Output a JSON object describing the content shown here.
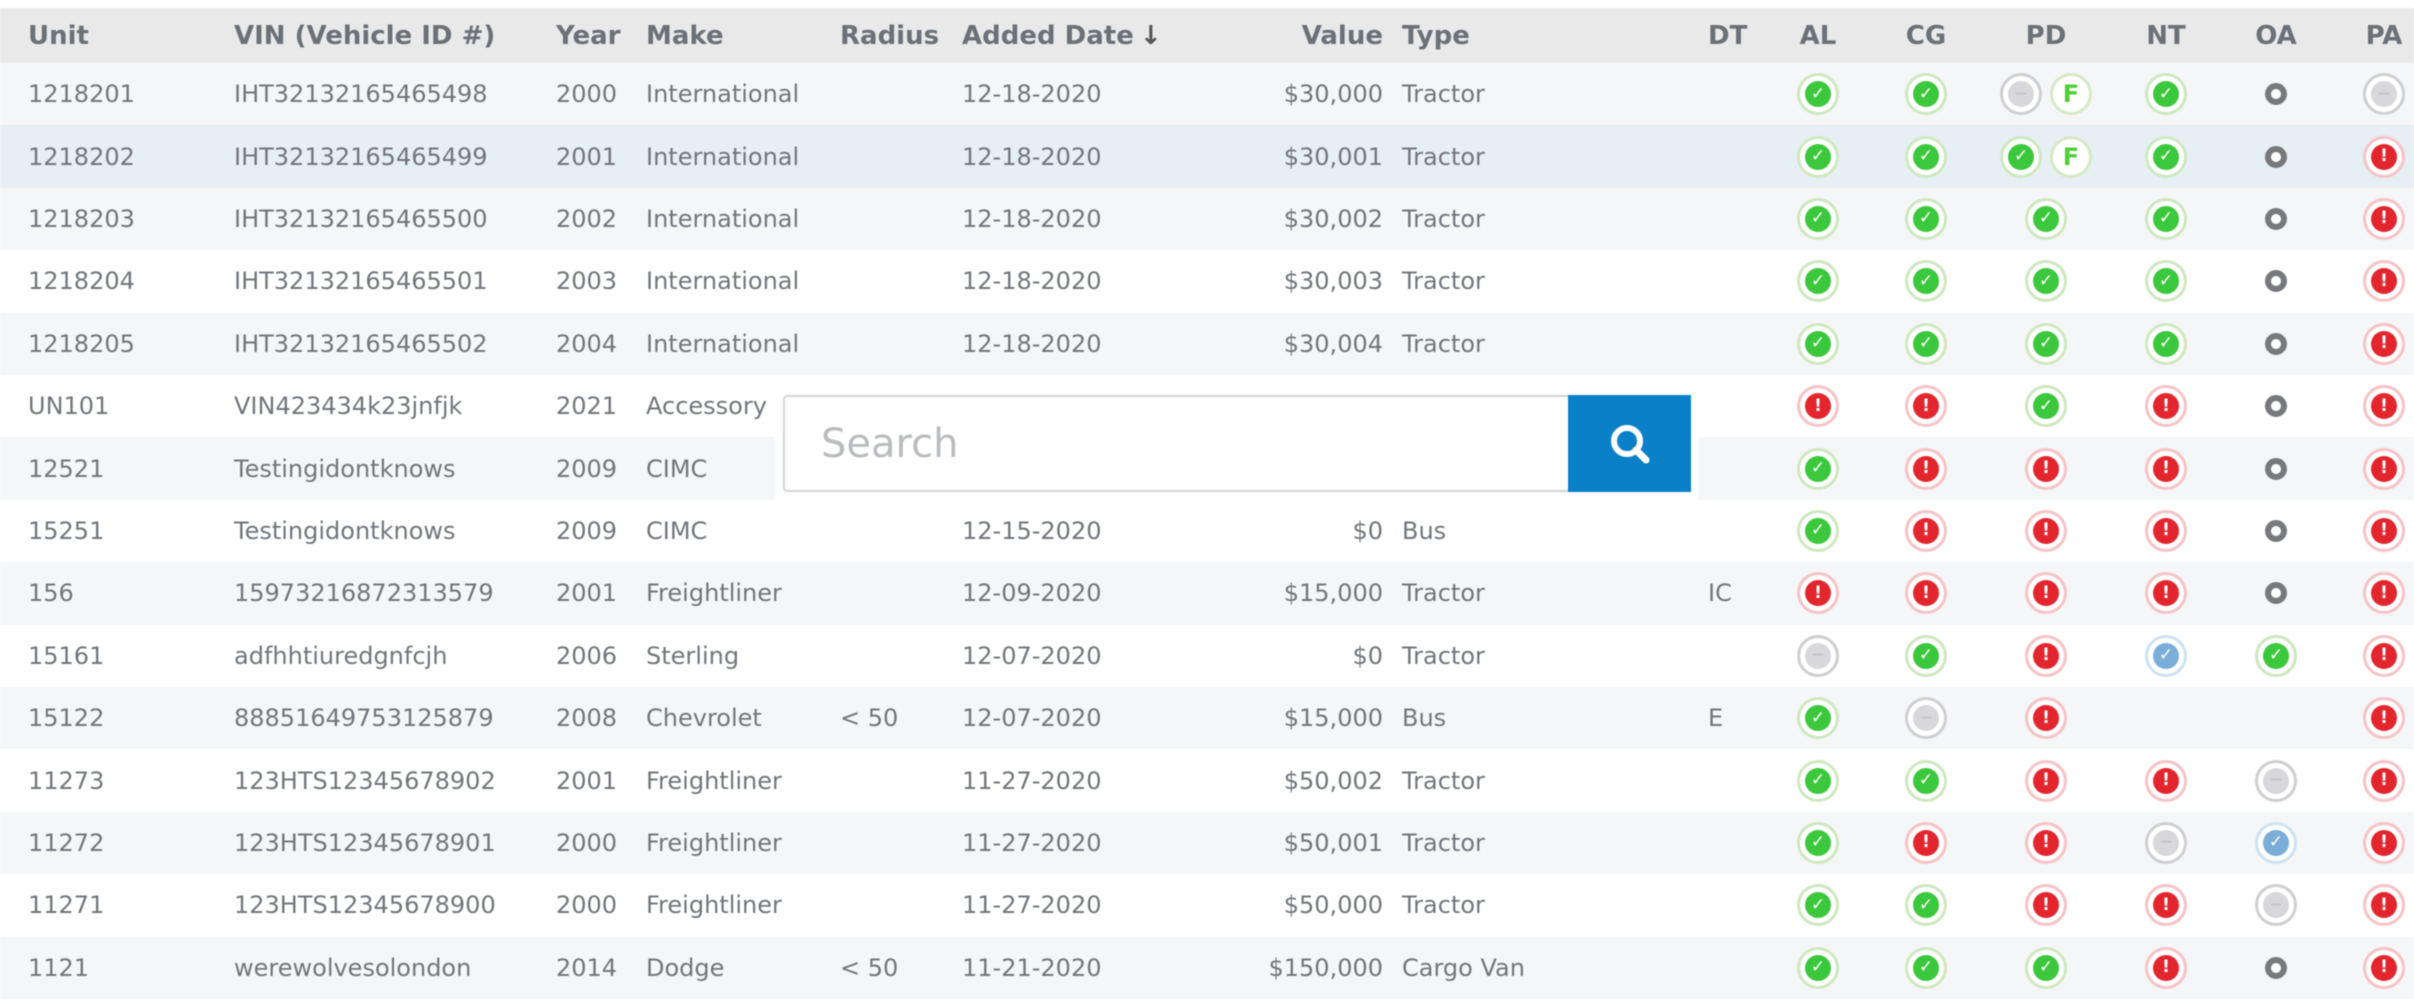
{
  "colors": {
    "accent": "#0a80c9",
    "ok": "#3cc83c",
    "alert": "#e3262e",
    "info": "#7aaed8",
    "neutral": "#d8d8da",
    "header_bg": "#e9e9ea",
    "row_alt_bg": "#f5f6f8",
    "row_selected_bg": "#e6eff4"
  },
  "search": {
    "placeholder": "Search",
    "value": "",
    "button_icon": "search-icon"
  },
  "table": {
    "columns": [
      {
        "key": "unit",
        "label": "Unit"
      },
      {
        "key": "vin",
        "label": "VIN (Vehicle ID #)"
      },
      {
        "key": "year",
        "label": "Year"
      },
      {
        "key": "make",
        "label": "Make"
      },
      {
        "key": "radius",
        "label": "Radius"
      },
      {
        "key": "added_date",
        "label": "Added Date",
        "sort": "descending",
        "sort_icon": "↓"
      },
      {
        "key": "value",
        "label": "Value"
      },
      {
        "key": "type",
        "label": "Type"
      },
      {
        "key": "dt",
        "label": "DT"
      },
      {
        "key": "al",
        "label": "AL"
      },
      {
        "key": "cg",
        "label": "CG"
      },
      {
        "key": "pd",
        "label": "PD"
      },
      {
        "key": "nt",
        "label": "NT"
      },
      {
        "key": "oa",
        "label": "OA"
      },
      {
        "key": "pa",
        "label": "PA"
      }
    ],
    "status_legend": {
      "ok": "check-circle-icon",
      "alert": "exclamation-circle-icon",
      "minus": "minus-circle-icon",
      "info": "check-circle-blue-icon",
      "flag": "f-badge-icon",
      "plus": "ring-icon",
      "none": ""
    },
    "selected_row_index": 1,
    "rows": [
      {
        "unit": "1218201",
        "vin": "IHT32132165465498",
        "year": "2000",
        "make": "International",
        "radius": "",
        "added_date": "12-18-2020",
        "value": "$30,000",
        "type": "Tractor",
        "dt": "",
        "al": [
          "ok"
        ],
        "cg": [
          "ok"
        ],
        "pd": [
          "minus",
          "flag"
        ],
        "nt": [
          "ok"
        ],
        "oa": [
          "plus"
        ],
        "pa": [
          "minus"
        ]
      },
      {
        "unit": "1218202",
        "vin": "IHT32132165465499",
        "year": "2001",
        "make": "International",
        "radius": "",
        "added_date": "12-18-2020",
        "value": "$30,001",
        "type": "Tractor",
        "dt": "",
        "al": [
          "ok"
        ],
        "cg": [
          "ok"
        ],
        "pd": [
          "ok",
          "flag"
        ],
        "nt": [
          "ok"
        ],
        "oa": [
          "plus"
        ],
        "pa": [
          "alert"
        ]
      },
      {
        "unit": "1218203",
        "vin": "IHT32132165465500",
        "year": "2002",
        "make": "International",
        "radius": "",
        "added_date": "12-18-2020",
        "value": "$30,002",
        "type": "Tractor",
        "dt": "",
        "al": [
          "ok"
        ],
        "cg": [
          "ok"
        ],
        "pd": [
          "ok"
        ],
        "nt": [
          "ok"
        ],
        "oa": [
          "plus"
        ],
        "pa": [
          "alert"
        ]
      },
      {
        "unit": "1218204",
        "vin": "IHT32132165465501",
        "year": "2003",
        "make": "International",
        "radius": "",
        "added_date": "12-18-2020",
        "value": "$30,003",
        "type": "Tractor",
        "dt": "",
        "al": [
          "ok"
        ],
        "cg": [
          "ok"
        ],
        "pd": [
          "ok"
        ],
        "nt": [
          "ok"
        ],
        "oa": [
          "plus"
        ],
        "pa": [
          "alert"
        ]
      },
      {
        "unit": "1218205",
        "vin": "IHT32132165465502",
        "year": "2004",
        "make": "International",
        "radius": "",
        "added_date": "12-18-2020",
        "value": "$30,004",
        "type": "Tractor",
        "dt": "",
        "al": [
          "ok"
        ],
        "cg": [
          "ok"
        ],
        "pd": [
          "ok"
        ],
        "nt": [
          "ok"
        ],
        "oa": [
          "plus"
        ],
        "pa": [
          "alert"
        ]
      },
      {
        "unit": "UN101",
        "vin": "VIN423434k23jnfjk",
        "year": "2021",
        "make": "Accessory",
        "radius": "",
        "added_date": "",
        "value": "",
        "type": "",
        "dt": "",
        "al": [
          "alert"
        ],
        "cg": [
          "alert"
        ],
        "pd": [
          "ok"
        ],
        "nt": [
          "alert"
        ],
        "oa": [
          "plus"
        ],
        "pa": [
          "alert"
        ]
      },
      {
        "unit": "12521",
        "vin": "Testingidontknows",
        "year": "2009",
        "make": "CIMC",
        "radius": "",
        "added_date": "",
        "value": "",
        "type": "",
        "dt": "",
        "al": [
          "ok"
        ],
        "cg": [
          "alert"
        ],
        "pd": [
          "alert"
        ],
        "nt": [
          "alert"
        ],
        "oa": [
          "plus"
        ],
        "pa": [
          "alert"
        ]
      },
      {
        "unit": "15251",
        "vin": "Testingidontknows",
        "year": "2009",
        "make": "CIMC",
        "radius": "",
        "added_date": "12-15-2020",
        "value": "$0",
        "type": "Bus",
        "dt": "",
        "al": [
          "ok"
        ],
        "cg": [
          "alert"
        ],
        "pd": [
          "alert"
        ],
        "nt": [
          "alert"
        ],
        "oa": [
          "plus"
        ],
        "pa": [
          "alert"
        ]
      },
      {
        "unit": "156",
        "vin": "15973216872313579",
        "year": "2001",
        "make": "Freightliner",
        "radius": "",
        "added_date": "12-09-2020",
        "value": "$15,000",
        "type": "Tractor",
        "dt": "IC",
        "al": [
          "alert"
        ],
        "cg": [
          "alert"
        ],
        "pd": [
          "alert"
        ],
        "nt": [
          "alert"
        ],
        "oa": [
          "plus"
        ],
        "pa": [
          "alert"
        ]
      },
      {
        "unit": "15161",
        "vin": "adfhhtiuredgnfcjh",
        "year": "2006",
        "make": "Sterling",
        "radius": "",
        "added_date": "12-07-2020",
        "value": "$0",
        "type": "Tractor",
        "dt": "",
        "al": [
          "minus"
        ],
        "cg": [
          "ok"
        ],
        "pd": [
          "alert"
        ],
        "nt": [
          "info"
        ],
        "oa": [
          "ok"
        ],
        "pa": [
          "alert"
        ]
      },
      {
        "unit": "15122",
        "vin": "88851649753125879",
        "year": "2008",
        "make": "Chevrolet",
        "radius": "< 50",
        "added_date": "12-07-2020",
        "value": "$15,000",
        "type": "Bus",
        "dt": "E",
        "al": [
          "ok"
        ],
        "cg": [
          "minus"
        ],
        "pd": [
          "alert"
        ],
        "nt": [],
        "oa": [],
        "pa": [
          "alert"
        ]
      },
      {
        "unit": "11273",
        "vin": "123HTS12345678902",
        "year": "2001",
        "make": "Freightliner",
        "radius": "",
        "added_date": "11-27-2020",
        "value": "$50,002",
        "type": "Tractor",
        "dt": "",
        "al": [
          "ok"
        ],
        "cg": [
          "ok"
        ],
        "pd": [
          "alert"
        ],
        "nt": [
          "alert"
        ],
        "oa": [
          "minus"
        ],
        "pa": [
          "alert"
        ]
      },
      {
        "unit": "11272",
        "vin": "123HTS12345678901",
        "year": "2000",
        "make": "Freightliner",
        "radius": "",
        "added_date": "11-27-2020",
        "value": "$50,001",
        "type": "Tractor",
        "dt": "",
        "al": [
          "ok"
        ],
        "cg": [
          "alert"
        ],
        "pd": [
          "alert"
        ],
        "nt": [
          "minus"
        ],
        "oa": [
          "info"
        ],
        "pa": [
          "alert"
        ]
      },
      {
        "unit": "11271",
        "vin": "123HTS12345678900",
        "year": "2000",
        "make": "Freightliner",
        "radius": "",
        "added_date": "11-27-2020",
        "value": "$50,000",
        "type": "Tractor",
        "dt": "",
        "al": [
          "ok"
        ],
        "cg": [
          "ok"
        ],
        "pd": [
          "alert"
        ],
        "nt": [
          "alert"
        ],
        "oa": [
          "minus"
        ],
        "pa": [
          "alert"
        ]
      },
      {
        "unit": "1121",
        "vin": "werewolvesolondon",
        "year": "2014",
        "make": "Dodge",
        "radius": "< 50",
        "added_date": "11-21-2020",
        "value": "$150,000",
        "type": "Cargo Van",
        "dt": "",
        "al": [
          "ok"
        ],
        "cg": [
          "ok"
        ],
        "pd": [
          "ok"
        ],
        "nt": [
          "alert"
        ],
        "oa": [
          "plus"
        ],
        "pa": [
          "alert"
        ]
      }
    ]
  }
}
